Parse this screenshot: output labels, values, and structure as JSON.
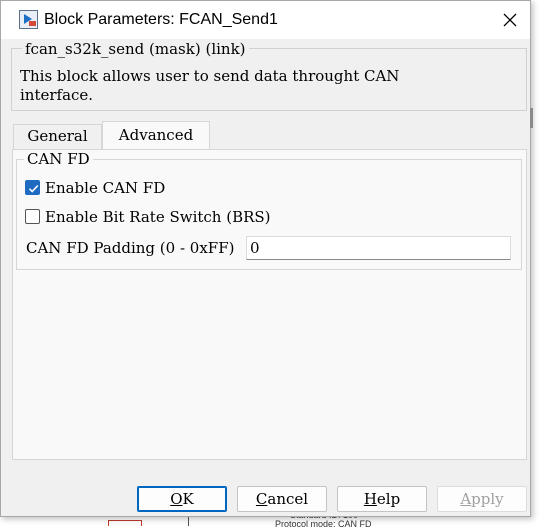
{
  "window": {
    "title": "Block Parameters: FCAN_Send1",
    "icon": "simulink-block-icon",
    "close_icon": "close-icon"
  },
  "description": {
    "header": "fcan_s32k_send (mask) (link)",
    "text": "This block allows user to send data throught CAN\ninterface."
  },
  "tabs": [
    {
      "label": "General",
      "active": false
    },
    {
      "label": "Advanced",
      "active": true
    }
  ],
  "can_fd": {
    "group_label": "CAN FD",
    "enable_can_fd": {
      "label": "Enable CAN FD",
      "checked": true
    },
    "enable_brs": {
      "label": "Enable Bit Rate Switch (BRS)",
      "checked": false
    },
    "padding": {
      "label": "CAN FD Padding (0 - 0xFF)",
      "value": "0"
    }
  },
  "buttons": {
    "ok": {
      "mnemonic": "O",
      "rest": "K"
    },
    "cancel": {
      "mnemonic": "C",
      "rest": "ancel"
    },
    "help": {
      "mnemonic": "H",
      "rest": "elp"
    },
    "apply": {
      "mnemonic": "A",
      "rest": "pply",
      "enabled": false
    }
  },
  "background": {
    "line1": "Standard ID: 100",
    "line2": "Protocol mode: CAN FD"
  },
  "colors": {
    "accent": "#1f6bc1",
    "dialog_bg": "#f0f0f0",
    "panel_bg": "#f9f9f9"
  }
}
